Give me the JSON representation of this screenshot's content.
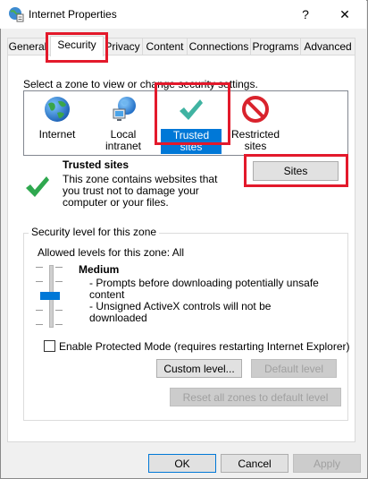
{
  "window": {
    "title": "Internet Properties",
    "help": "?",
    "close": "✕"
  },
  "tabs": [
    "General",
    "Security",
    "Privacy",
    "Content",
    "Connections",
    "Programs",
    "Advanced"
  ],
  "security": {
    "zone_prompt": "Select a zone to view or change security settings.",
    "zones": [
      {
        "label": "Internet",
        "icon": "globe-icon"
      },
      {
        "label": "Local intranet",
        "icon": "intranet-icon"
      },
      {
        "label": "Trusted sites",
        "icon": "checkmark-icon",
        "selected": true
      },
      {
        "label": "Restricted sites",
        "icon": "restricted-icon"
      }
    ],
    "selected_zone": {
      "title": "Trusted sites",
      "description": "This zone contains websites that you trust not to damage your computer or your files.",
      "sites_button": "Sites"
    },
    "level_group": {
      "label": "Security level for this zone",
      "allowed": "Allowed levels for this zone: All",
      "level_name": "Medium",
      "bullets": [
        "- Prompts before downloading potentially unsafe content",
        "- Unsigned ActiveX controls will not be downloaded"
      ],
      "protected_mode": "Enable Protected Mode (requires restarting Internet Explorer)",
      "protected_mode_checked": false,
      "custom_level": "Custom level...",
      "default_level": "Default level"
    },
    "reset_all": "Reset all zones to default level"
  },
  "footer": {
    "ok": "OK",
    "cancel": "Cancel",
    "apply": "Apply"
  },
  "colors": {
    "highlight_red": "#e3192b",
    "selection_blue": "#0078d7",
    "check_green": "#2fa84f"
  }
}
